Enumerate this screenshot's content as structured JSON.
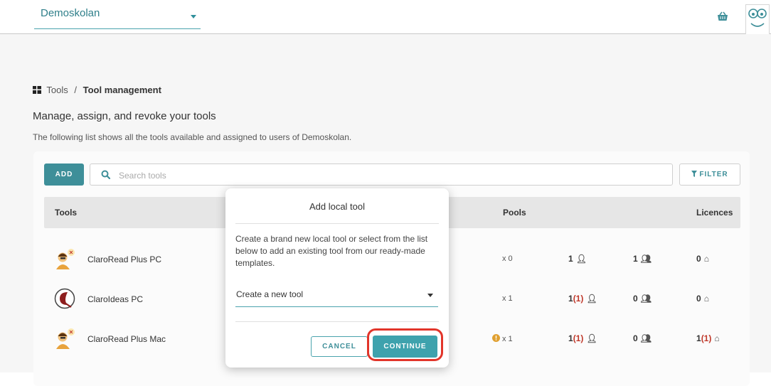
{
  "topbar": {
    "school_selector": "Demoskolan",
    "basket_icon": "basket-icon",
    "mascot_icon": "mascot-face-icon"
  },
  "breadcrumb": {
    "icon": "grid-icon",
    "root": "Tools",
    "separator": "/",
    "current": "Tool management"
  },
  "page": {
    "title": "Manage, assign, and revoke your tools",
    "description": "The following list shows all the tools available and assigned to users of Demoskolan."
  },
  "toolbar": {
    "add_label": "ADD",
    "search_placeholder": "Search tools",
    "filter_label": "FILTER"
  },
  "table": {
    "headers": {
      "tools": "Tools",
      "pools": "Pools",
      "licences": "Licences"
    },
    "rows": [
      {
        "name": "ClaroRead Plus PC",
        "logo": "claroread-logo",
        "pool": "x 0",
        "users_count": "1",
        "users_extra": "",
        "groups_count": "1",
        "groups_extra": "",
        "schools_count": "0",
        "schools_extra": "",
        "warning": false
      },
      {
        "name": "ClaroIdeas PC",
        "logo": "claroideas-logo",
        "pool": "x 1",
        "users_count": "1",
        "users_extra": "(1)",
        "groups_count": "0",
        "groups_extra": "",
        "schools_count": "0",
        "schools_extra": "",
        "warning": false
      },
      {
        "name": "ClaroRead Plus Mac",
        "logo": "claroread-logo",
        "pool": "x 1",
        "users_count": "1",
        "users_extra": "(1)",
        "groups_count": "0",
        "groups_extra": "",
        "schools_count": "1",
        "schools_extra": "(1)",
        "warning": true
      }
    ]
  },
  "modal": {
    "title": "Add local tool",
    "body": "Create a brand new local tool or select from the list below to add an existing tool from our ready-made templates.",
    "selected_option": "Create a new tool",
    "cancel_label": "CANCEL",
    "continue_label": "CONTINUE"
  },
  "colors": {
    "accent": "#3e8f99",
    "highlight": "#e2352a",
    "count_red": "#c0392b"
  }
}
